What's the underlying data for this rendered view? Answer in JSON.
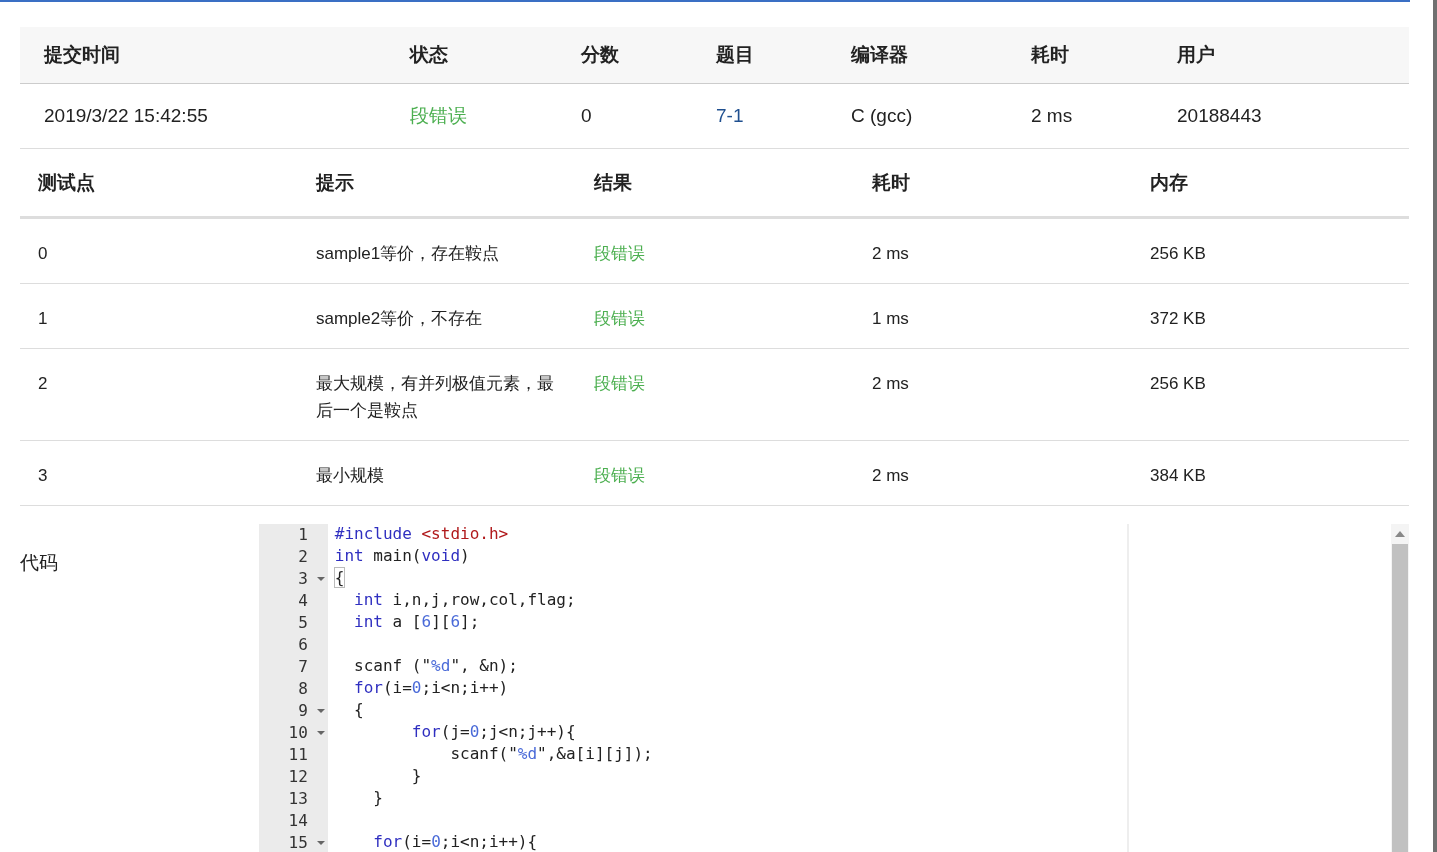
{
  "submission": {
    "columns": [
      "提交时间",
      "状态",
      "分数",
      "题目",
      "编译器",
      "耗时",
      "用户"
    ],
    "row": {
      "time": "2019/3/22 15:42:55",
      "status": "段错误",
      "score": "0",
      "problem": "7-1",
      "compiler": "C (gcc)",
      "duration": "2 ms",
      "user": "20188443"
    }
  },
  "tests": {
    "columns": [
      "测试点",
      "提示",
      "结果",
      "耗时",
      "内存"
    ],
    "rows": [
      {
        "case": "0",
        "hint": "sample1等价，存在鞍点",
        "result": "段错误",
        "time": "2 ms",
        "memory": "256 KB"
      },
      {
        "case": "1",
        "hint": "sample2等价，不存在",
        "result": "段错误",
        "time": "1 ms",
        "memory": "372 KB"
      },
      {
        "case": "2",
        "hint": "最大规模，有并列极值元素，最后一个是鞍点",
        "result": "段错误",
        "time": "2 ms",
        "memory": "256 KB"
      },
      {
        "case": "3",
        "hint": "最小规模",
        "result": "段错误",
        "time": "2 ms",
        "memory": "384 KB"
      }
    ]
  },
  "code": {
    "label": "代码",
    "lines": [
      {
        "number": "1",
        "fold": false,
        "tokens": [
          {
            "kind": "keyword",
            "text": "#include"
          },
          {
            "kind": "header",
            "text": " <stdio.h>"
          }
        ]
      },
      {
        "number": "2",
        "fold": false,
        "tokens": [
          {
            "kind": "keyword",
            "text": "int"
          },
          {
            "kind": "plain",
            "text": " main("
          },
          {
            "kind": "keyword",
            "text": "void"
          },
          {
            "kind": "plain",
            "text": ")"
          }
        ]
      },
      {
        "number": "3",
        "fold": true,
        "tokens": [
          {
            "kind": "match",
            "text": "{"
          }
        ]
      },
      {
        "number": "4",
        "fold": false,
        "tokens": [
          {
            "kind": "keyword",
            "text": "  int"
          },
          {
            "kind": "plain",
            "text": " i,n,j,row,col,flag;"
          }
        ]
      },
      {
        "number": "5",
        "fold": false,
        "tokens": [
          {
            "kind": "keyword",
            "text": "  int"
          },
          {
            "kind": "plain",
            "text": " a ["
          },
          {
            "kind": "number",
            "text": "6"
          },
          {
            "kind": "plain",
            "text": "]["
          },
          {
            "kind": "number",
            "text": "6"
          },
          {
            "kind": "plain",
            "text": "];"
          }
        ]
      },
      {
        "number": "6",
        "fold": false
      },
      {
        "number": "7",
        "fold": false,
        "tokens": [
          {
            "kind": "plain",
            "text": "  scanf (\""
          },
          {
            "kind": "string",
            "text": "%d"
          },
          {
            "kind": "plain",
            "text": "\", &n);"
          }
        ]
      },
      {
        "number": "8",
        "fold": false,
        "tokens": [
          {
            "kind": "keyword",
            "text": "  for"
          },
          {
            "kind": "plain",
            "text": "(i="
          },
          {
            "kind": "number",
            "text": "0"
          },
          {
            "kind": "plain",
            "text": ";i<n;i++)"
          }
        ]
      },
      {
        "number": "9",
        "fold": true,
        "tokens": [
          {
            "kind": "plain",
            "text": "  {"
          }
        ]
      },
      {
        "number": "10",
        "fold": true,
        "tokens": [
          {
            "kind": "keyword",
            "text": "        for"
          },
          {
            "kind": "plain",
            "text": "(j="
          },
          {
            "kind": "number",
            "text": "0"
          },
          {
            "kind": "plain",
            "text": ";j<n;j++){"
          }
        ]
      },
      {
        "number": "11",
        "fold": false,
        "tokens": [
          {
            "kind": "plain",
            "text": "            scanf(\""
          },
          {
            "kind": "string",
            "text": "%d"
          },
          {
            "kind": "plain",
            "text": "\",&a[i][j]);"
          }
        ]
      },
      {
        "number": "12",
        "fold": false,
        "tokens": [
          {
            "kind": "plain",
            "text": "        }"
          }
        ]
      },
      {
        "number": "13",
        "fold": false,
        "tokens": [
          {
            "kind": "plain",
            "text": "    }"
          }
        ]
      },
      {
        "number": "14",
        "fold": false
      },
      {
        "number": "15",
        "fold": true,
        "tokens": [
          {
            "kind": "keyword",
            "text": "    for"
          },
          {
            "kind": "plain",
            "text": "(i="
          },
          {
            "kind": "number",
            "text": "0"
          },
          {
            "kind": "plain",
            "text": ";i<n;i++){"
          }
        ]
      }
    ]
  }
}
